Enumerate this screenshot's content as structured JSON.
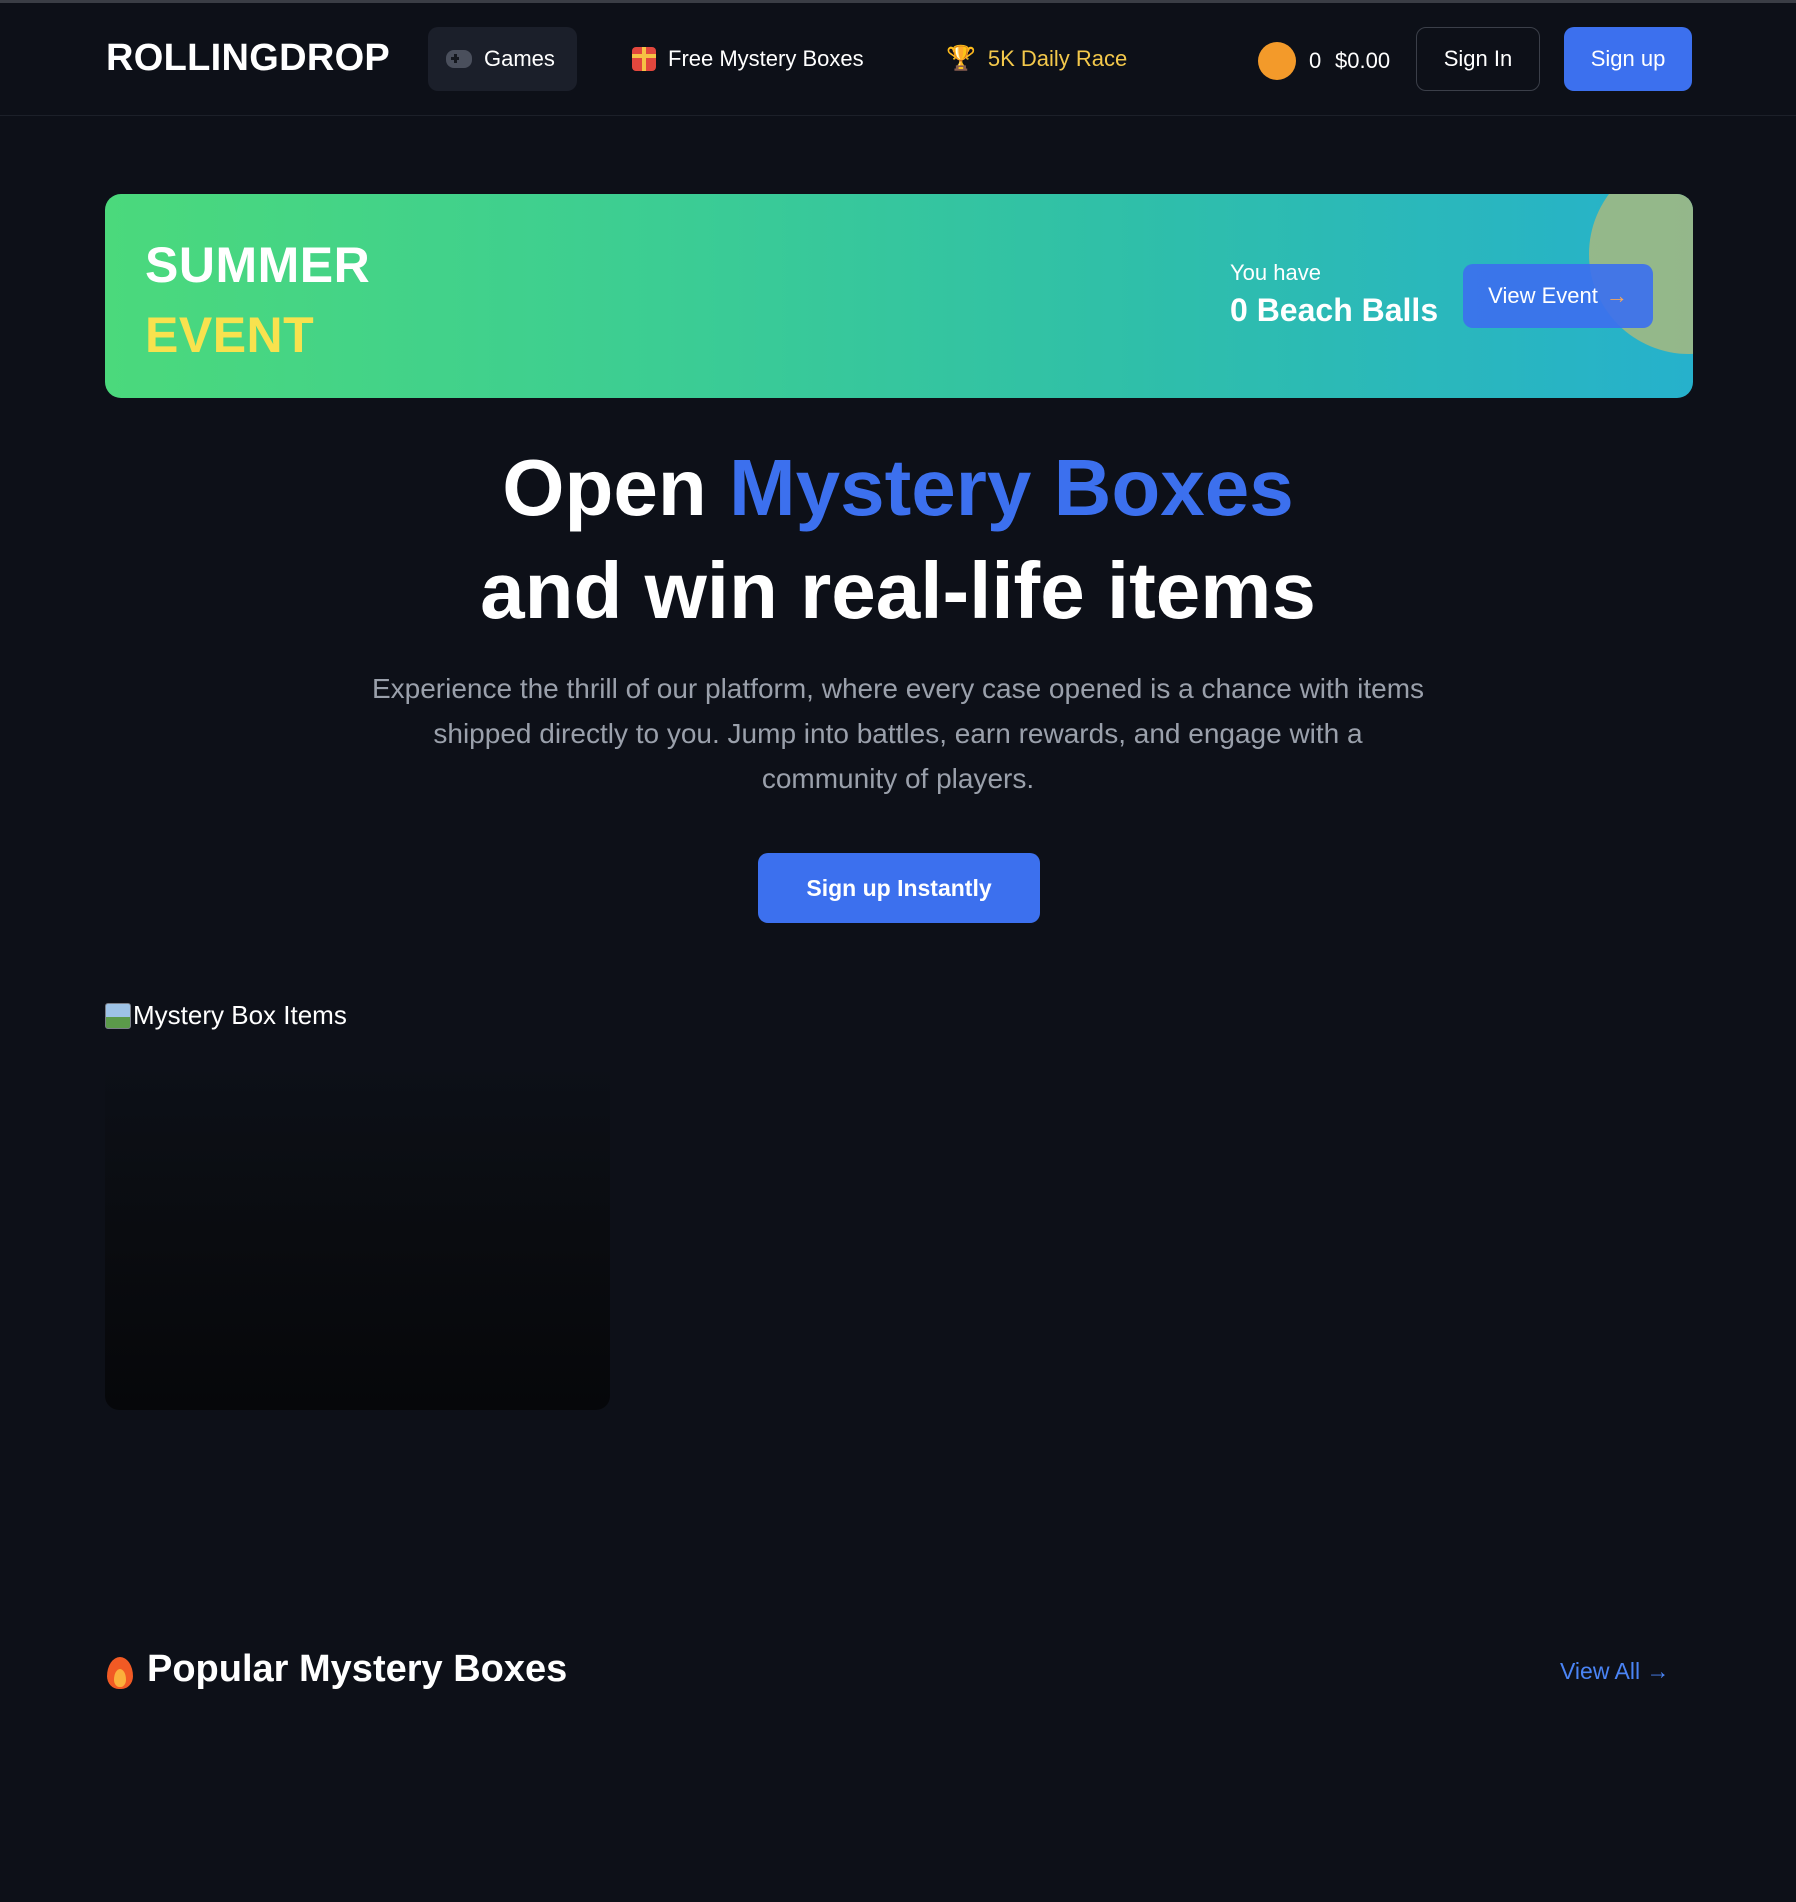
{
  "header": {
    "logo": "ROLLINGDROP",
    "nav": {
      "games": "Games",
      "free_boxes": "Free Mystery Boxes",
      "daily_race": "5K Daily Race"
    },
    "coin_count": "0",
    "balance": "$0.00",
    "sign_in": "Sign In",
    "sign_up": "Sign up"
  },
  "event_banner": {
    "title_line1": "SUMMER",
    "title_line2": "EVENT",
    "you_have": "You have",
    "beach_balls": "0 Beach Balls",
    "view_event": "View Event",
    "arrow": "→"
  },
  "hero": {
    "line1_prefix": "Open ",
    "line1_accent": "Mystery Boxes",
    "line2": "and win real-life items",
    "description": "Experience the thrill of our platform, where every case opened is a chance with items shipped directly to you. Jump into battles, earn rewards, and engage with a community of players.",
    "cta": "Sign up Instantly"
  },
  "showcase": {
    "image_alt": "Mystery Box Items"
  },
  "popular": {
    "title": "Popular Mystery Boxes",
    "view_all": "View All →"
  },
  "colors": {
    "background": "#0d1018",
    "accent": "#3c70ee",
    "race_gold": "#f3c84b",
    "coin": "#f39a2a",
    "event_yellow": "#f8e24e"
  },
  "icons": {
    "games": "gamepad-icon",
    "free_boxes": "gift-icon",
    "daily_race": "trophy-icon",
    "popular": "fire-icon"
  }
}
